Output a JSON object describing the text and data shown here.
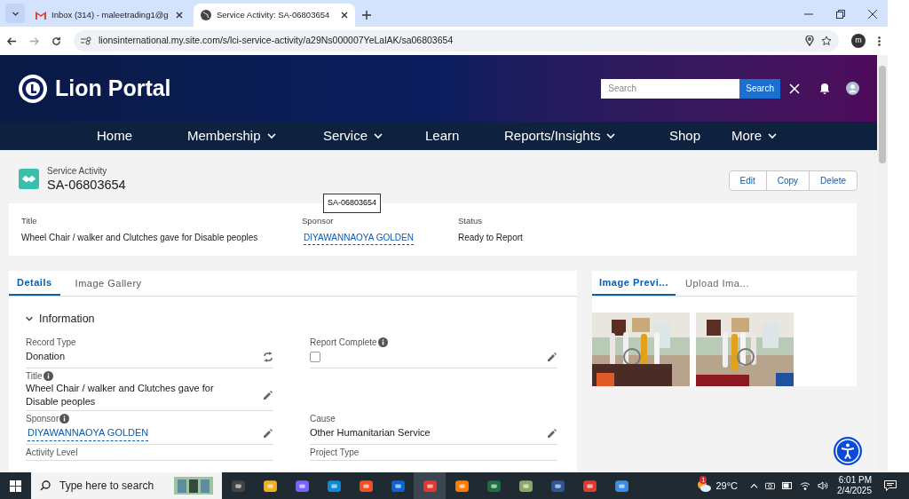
{
  "browser": {
    "tabs": [
      {
        "title": "Inbox (314) - maleetrading1@g",
        "selected": false
      },
      {
        "title": "Service Activity: SA-06803654",
        "selected": true
      }
    ],
    "url": "lionsinternational.my.site.com/s/lci-service-activity/a29Ns000007YeLalAK/sa06803654",
    "profile_initial": "m"
  },
  "portal": {
    "title": "Lion Portal",
    "search": {
      "placeholder": "Search",
      "button": "Search"
    },
    "nav": [
      {
        "label": "Home",
        "has_menu": false
      },
      {
        "label": "Membership",
        "has_menu": true
      },
      {
        "label": "Service",
        "has_menu": true
      },
      {
        "label": "Learn",
        "has_menu": false
      },
      {
        "label": "Reports/Insights",
        "has_menu": true
      },
      {
        "label": "Shop",
        "has_menu": false
      },
      {
        "label": "More",
        "has_menu": true
      }
    ]
  },
  "record": {
    "type_label": "Service Activity",
    "name": "SA-06803654",
    "tooltip": "SA-06803654",
    "actions": [
      "Edit",
      "Copy",
      "Delete"
    ]
  },
  "highlights": [
    {
      "label": "Title",
      "value": "Wheel Chair / walker and Clutches gave for Disable peoples",
      "kind": "text"
    },
    {
      "label": "Sponsor",
      "value": "DIYAWANNAOYA GOLDEN",
      "kind": "link"
    },
    {
      "label": "Status",
      "value": "Ready to Report",
      "kind": "text"
    }
  ],
  "detail_tabs": [
    {
      "label": "Details",
      "selected": true
    },
    {
      "label": "Image Gallery",
      "selected": false
    }
  ],
  "section": {
    "title": "Information",
    "expanded": true
  },
  "rows": [
    {
      "left": {
        "label": "Record Type",
        "kind": "record_type",
        "value": "Donation",
        "info": false,
        "editable": false
      },
      "right": {
        "label": "Report Complete",
        "kind": "checkbox",
        "checked": false,
        "info": true,
        "editable": true
      }
    },
    {
      "left": {
        "label": "Title",
        "kind": "text",
        "value": "Wheel Chair / walker and Clutches gave for Disable peoples",
        "info": true,
        "editable": true
      }
    },
    {
      "left": {
        "label": "Sponsor",
        "kind": "link",
        "value": "DIYAWANNAOYA GOLDEN",
        "info": true,
        "editable": true
      },
      "right": {
        "label": "Cause",
        "kind": "text",
        "value": "Other Humanitarian Service",
        "info": false,
        "editable": true
      }
    },
    {
      "left": {
        "label": "Activity Level",
        "kind": "empty",
        "info": false,
        "editable": false
      },
      "right": {
        "label": "Project Type",
        "kind": "empty",
        "info": false,
        "editable": false
      }
    }
  ],
  "image_panel": {
    "tabs": [
      {
        "label": "Image Previ...",
        "selected": true
      },
      {
        "label": "Upload Ima...",
        "selected": false
      }
    ]
  },
  "taskbar": {
    "search_placeholder": "Type here to search",
    "weather_badge": "1",
    "temperature": "29°C",
    "time": "6:01 PM",
    "date": "2/4/2025"
  }
}
